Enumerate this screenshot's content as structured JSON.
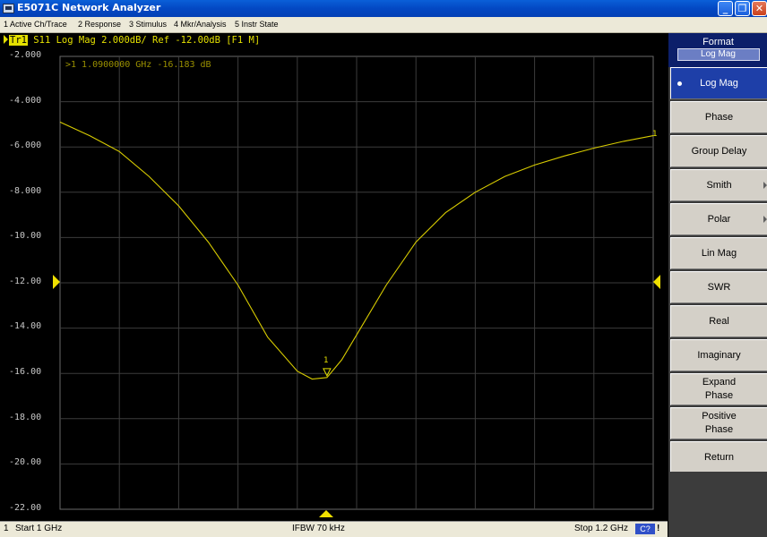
{
  "window": {
    "title": "E5071C Network Analyzer",
    "minimize_glyph": "_",
    "restore_glyph": "❐",
    "close_glyph": "✕"
  },
  "menu": [
    "1 Active Ch/Trace",
    "2 Response",
    "3 Stimulus",
    "4 Mkr/Analysis",
    "5 Instr State"
  ],
  "trace": {
    "id": "Tr1",
    "description": "S11 Log Mag 2.000dB/ Ref -12.00dB [F1 M]",
    "end_label": "1"
  },
  "marker": {
    "readout": ">1  1.0900000 GHz -16.183 dB",
    "label": "1",
    "x_ghz": 1.09,
    "y_db": -16.183
  },
  "y_axis": {
    "ticks": [
      "-2.000",
      "-4.000",
      "-6.000",
      "-8.000",
      "-10.00",
      "-12.00",
      "-14.00",
      "-16.00",
      "-18.00",
      "-20.00",
      "-22.00"
    ]
  },
  "status": {
    "channel": "1",
    "start": "Start 1 GHz",
    "ifbw": "IFBW 70 kHz",
    "stop": "Stop 1.2 GHz",
    "cal": "C?",
    "indicator": "!"
  },
  "panel": {
    "title": "Format",
    "current": "Log Mag",
    "softkeys": [
      {
        "label": "Log Mag",
        "active": true
      },
      {
        "label": "Phase"
      },
      {
        "label": "Group Delay"
      },
      {
        "label": "Smith",
        "submenu": true
      },
      {
        "label": "Polar",
        "submenu": true
      },
      {
        "label": "Lin Mag"
      },
      {
        "label": "SWR"
      },
      {
        "label": "Real"
      },
      {
        "label": "Imaginary"
      },
      {
        "label": "Expand\nPhase"
      },
      {
        "label": "Positive\nPhase"
      },
      {
        "label": "Return"
      }
    ]
  },
  "chart_data": {
    "type": "line",
    "xlabel": "",
    "ylabel": "",
    "xlim": [
      1.0,
      1.2
    ],
    "ylim": [
      -22.0,
      -2.0
    ],
    "grid": true,
    "series": [
      {
        "name": "S11",
        "color": "#d8cc00",
        "x": [
          1.0,
          1.01,
          1.02,
          1.03,
          1.04,
          1.05,
          1.06,
          1.07,
          1.08,
          1.085,
          1.09,
          1.095,
          1.1,
          1.11,
          1.12,
          1.13,
          1.14,
          1.15,
          1.16,
          1.17,
          1.18,
          1.19,
          1.2
        ],
        "y": [
          -4.9,
          -5.5,
          -6.2,
          -7.3,
          -8.6,
          -10.2,
          -12.1,
          -14.4,
          -15.9,
          -16.25,
          -16.18,
          -15.4,
          -14.3,
          -12.1,
          -10.2,
          -8.9,
          -8.0,
          -7.3,
          -6.8,
          -6.4,
          -6.05,
          -5.75,
          -5.5
        ]
      }
    ]
  }
}
